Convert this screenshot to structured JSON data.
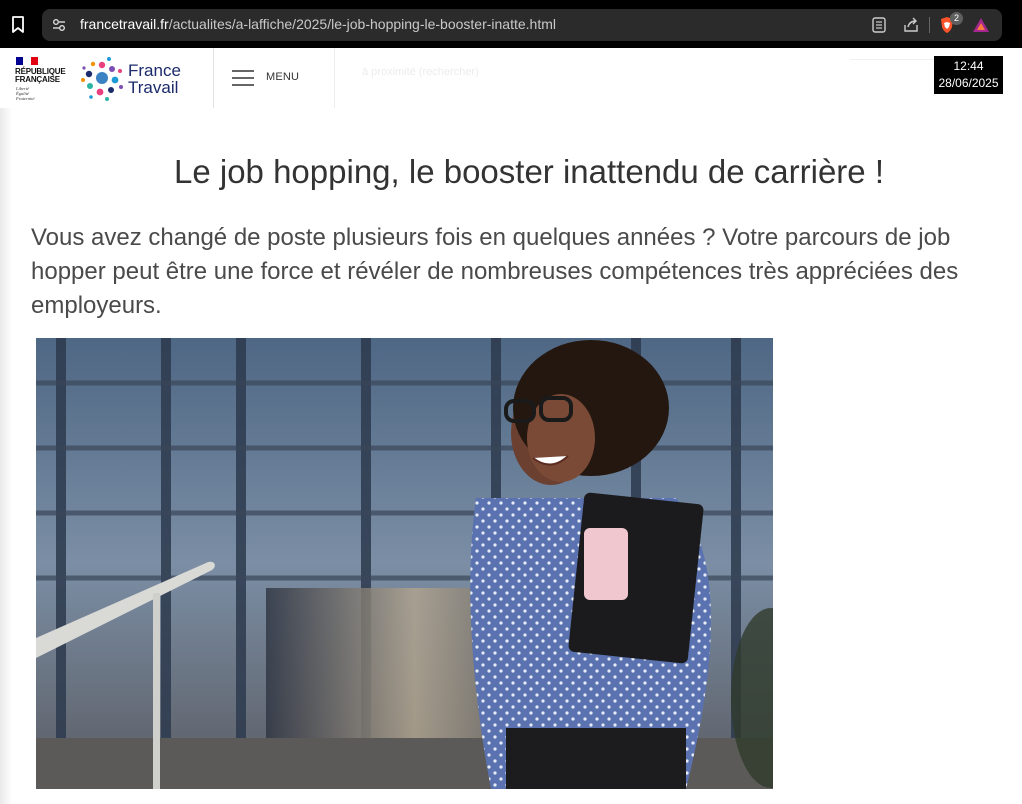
{
  "browser": {
    "url_host": "francetravail.fr",
    "url_path": "/actualites/a-laffiche/2025/le-job-hopping-le-booster-inatte.html",
    "shields_count": "2"
  },
  "header": {
    "rf_text": "RÉPUBLIQUE\nFRANÇAISE",
    "rf_motto": "Liberté\nÉgalité\nFraternité",
    "brand_line1": "France",
    "brand_line2": "Travail",
    "menu_label": "MENU",
    "search_placeholder": "à proximité (rechercher)",
    "clock_time": "12:44",
    "clock_date": "28/06/2025"
  },
  "article": {
    "title": "Le job hopping, le booster inattendu de carrière !",
    "lead": "Vous avez changé de poste plusieurs fois en quelques années ? Votre parcours de job hopper peut être une force et révéler de nombreuses compétences très appréciées des employeurs."
  },
  "colors": {
    "brand_navy": "#1b2b6b",
    "title_text": "#333333",
    "lead_text": "#4a4a4a"
  }
}
